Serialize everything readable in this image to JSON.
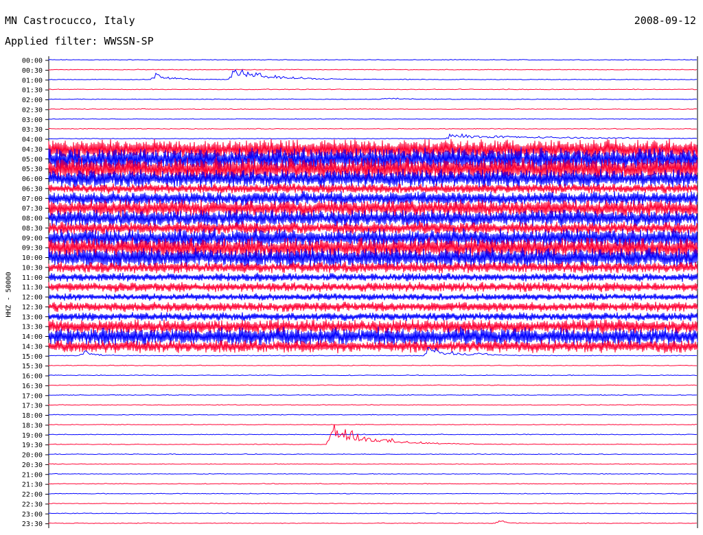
{
  "header": {
    "station": "MN Castrocucco, Italy",
    "date": "2008-09-12",
    "filter": "Applied filter: WWSSN-SP"
  },
  "chart_data": {
    "type": "line",
    "ylabel": "HHZ - 50000",
    "colors": {
      "even": "#0000ff",
      "odd": "#ff0033",
      "frame": "#000000"
    },
    "time_labels": [
      "00:00",
      "00:30",
      "01:00",
      "01:30",
      "02:00",
      "02:30",
      "03:00",
      "03:30",
      "04:00",
      "04:30",
      "05:00",
      "05:30",
      "06:00",
      "06:30",
      "07:00",
      "07:30",
      "08:00",
      "08:30",
      "09:00",
      "09:30",
      "10:00",
      "10:30",
      "11:00",
      "11:30",
      "12:00",
      "12:30",
      "13:00",
      "13:30",
      "14:00",
      "14:30",
      "15:00",
      "15:30",
      "16:00",
      "16:30",
      "17:00",
      "17:30",
      "18:00",
      "18:30",
      "19:00",
      "19:30",
      "20:00",
      "20:30",
      "21:00",
      "21:30",
      "22:00",
      "22:30",
      "23:00",
      "23:30"
    ],
    "x_span_minutes": 30,
    "noise_level": [
      1,
      1,
      1,
      1,
      1,
      1,
      1,
      1,
      2,
      14,
      16,
      16,
      13,
      7,
      10,
      12,
      12,
      9,
      13,
      14,
      14,
      8,
      6,
      7,
      5,
      7,
      6,
      10,
      13,
      9,
      2,
      2,
      2,
      2,
      2,
      2,
      2,
      1,
      1,
      1,
      1,
      1,
      1,
      1,
      1,
      1,
      1,
      1
    ],
    "events": [
      {
        "trace": 2,
        "minute": 4.9,
        "amplitude": 12,
        "duration": 1.5
      },
      {
        "trace": 2,
        "minute": 8.5,
        "amplitude": 24,
        "duration": 3.5
      },
      {
        "trace": 4,
        "minute": 15.5,
        "amplitude": 3,
        "duration": 2
      },
      {
        "trace": 8,
        "minute": 18.5,
        "amplitude": 8,
        "duration": 11
      },
      {
        "trace": 30,
        "minute": 1.6,
        "amplitude": 10,
        "duration": 1
      },
      {
        "trace": 30,
        "minute": 17.5,
        "amplitude": 18,
        "duration": 2.5
      },
      {
        "trace": 30,
        "minute": 19.8,
        "amplitude": 6,
        "duration": 1
      },
      {
        "trace": 39,
        "minute": 13.0,
        "amplitude": 40,
        "duration": 4
      },
      {
        "trace": 47,
        "minute": 20.8,
        "amplitude": 8,
        "duration": 0.6
      }
    ]
  }
}
